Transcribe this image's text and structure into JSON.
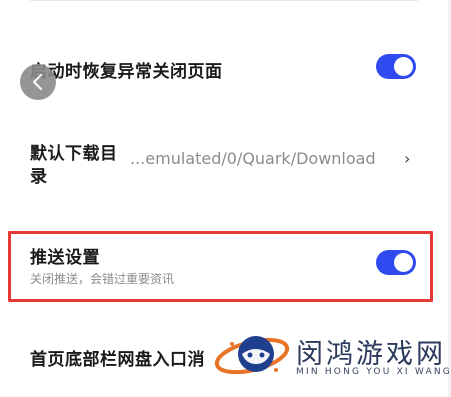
{
  "settings": {
    "restore_pages": {
      "title": "启动时恢复异常关闭页面",
      "enabled": true
    },
    "download_dir": {
      "title_line1": "默认下载目",
      "title_line2": "录",
      "value": "...emulated/0/Quark/Download",
      "chevron": "›"
    },
    "push": {
      "title": "推送设置",
      "subtitle": "关闭推送，会错过重要资讯",
      "enabled": true
    },
    "bottom_bar": {
      "title": "首页底部栏网盘入口消"
    }
  },
  "back_button": {
    "icon": "chevron-left-icon",
    "glyph": "‹"
  },
  "watermark": {
    "title": "闵鸿游戏网",
    "subtitle": "MIN HONG YOU XI WANG"
  },
  "colors": {
    "toggle_on": "#2f4bf0",
    "highlight": "#e53935",
    "title_text": "#1a1a1a",
    "sub_text": "#8c8c8c"
  }
}
